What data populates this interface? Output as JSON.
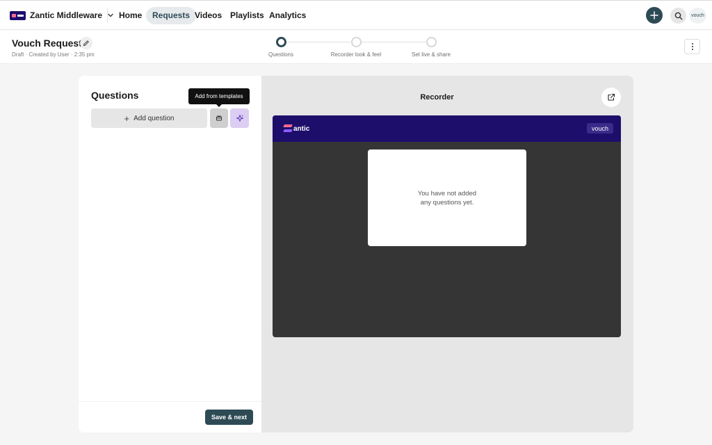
{
  "nav": {
    "brand": "Zantic Middleware",
    "items": [
      {
        "label": "Home"
      },
      {
        "label": "Requests",
        "active": true
      },
      {
        "label": "Videos"
      },
      {
        "label": "Playlists"
      },
      {
        "label": "Analytics"
      }
    ],
    "avatar_label": "vouch"
  },
  "header": {
    "title": "Vouch Request",
    "meta": "Draft · Created by User · 2:35 pm",
    "steps": [
      {
        "label": "Questions",
        "current": true
      },
      {
        "label": "Recorder look & feel",
        "current": false
      },
      {
        "label": "Set live & share",
        "current": false
      }
    ]
  },
  "questions": {
    "title": "Questions",
    "add_button": "Add question",
    "tooltip": "Add from templates",
    "save_button": "Save & next"
  },
  "recorder": {
    "title": "Recorder",
    "logo_text": "antic",
    "badge": "vouch",
    "empty_text": "You have not added any questions yet."
  },
  "colors": {
    "accent": "#2e4a55",
    "brand_navy": "#1d0e6b",
    "ai_purple": "#dccdf3",
    "recorder_bg": "#353535"
  },
  "icons": [
    "chevron-down-icon",
    "plus-icon",
    "search-icon",
    "pencil-icon",
    "more-vertical-icon",
    "template-icon",
    "sparkle-icon",
    "external-link-icon"
  ]
}
